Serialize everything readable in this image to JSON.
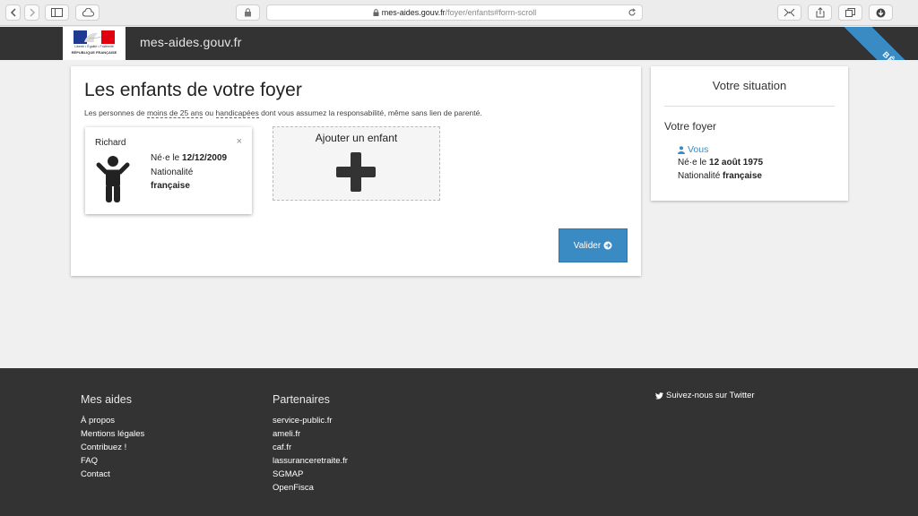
{
  "browser": {
    "url_host": "mes-aides.gouv.fr",
    "url_path": "/foyer/enfants#form-scroll"
  },
  "header": {
    "logo_line1": "Liberté • Égalité • Fraternité",
    "logo_line2": "RÉPUBLIQUE FRANÇAISE",
    "brand": "mes-aides.gouv.fr",
    "beta": "BÊTA"
  },
  "main": {
    "title": "Les enfants de votre foyer",
    "intro_pre": "Les personnes de ",
    "intro_age": "moins de 25 ans",
    "intro_mid": " ou ",
    "intro_handi": "handicapées",
    "intro_post": " dont vous assumez la responsabilité, même sans lien de parenté.",
    "child": {
      "name": "Richard",
      "close": "×",
      "born_label": "Né·e le ",
      "born_date": "12/12/2009",
      "nat_label": "Nationalité",
      "nat_value": "française"
    },
    "add_label": "Ajouter un enfant",
    "submit_label": "Valider"
  },
  "sidebar": {
    "title": "Votre situation",
    "foyer": "Votre foyer",
    "vous": "Vous",
    "born_label": "Né·e le ",
    "born_date": "12 août 1975",
    "nat_label": "Nationalité ",
    "nat_value": "française"
  },
  "footer": {
    "col1_title": "Mes aides",
    "col1_links": [
      "À propos",
      "Mentions légales",
      "Contribuez !",
      "FAQ",
      "Contact"
    ],
    "col2_title": "Partenaires",
    "col2_links": [
      "service-public.fr",
      "ameli.fr",
      "caf.fr",
      "lassuranceretraite.fr",
      "SGMAP",
      "OpenFisca"
    ],
    "twitter": "Suivez-nous sur Twitter"
  },
  "colors": {
    "accent": "#3a8bc4",
    "header_bg": "#333333",
    "page_bg": "#f0f0f0"
  },
  "icons": [
    "back-icon",
    "forward-icon",
    "sidebar-icon",
    "cloud-icon",
    "privacy-icon",
    "lock-icon",
    "reload-icon",
    "extensions-icon",
    "share-icon",
    "tabs-icon",
    "download-icon",
    "child-icon",
    "plus-icon",
    "arrow-circle-right-icon",
    "user-icon",
    "twitter-icon"
  ]
}
